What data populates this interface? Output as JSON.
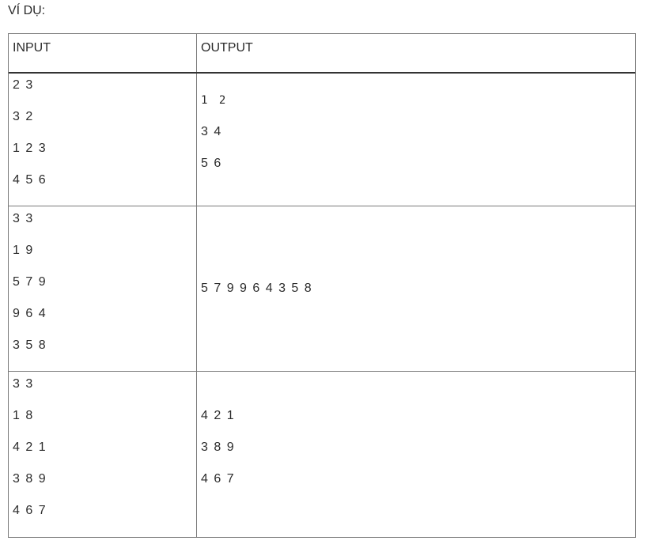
{
  "heading": "VÍ DỤ:",
  "table": {
    "headers": {
      "input": "INPUT",
      "output": "OUTPUT"
    },
    "rows": [
      {
        "input": [
          "2 3",
          "3 2",
          "1 2 3",
          "4 5 6"
        ],
        "output": [
          "1 2",
          "3 4",
          "5 6"
        ]
      },
      {
        "input": [
          "3 3",
          "1 9",
          "5 7 9",
          "9 6 4",
          "3 5 8"
        ],
        "output": [
          "5 7 9 9 6 4 3 5 8"
        ]
      },
      {
        "input": [
          "3 3",
          "1 8",
          "4 2 1",
          "3 8 9",
          "4 6 7"
        ],
        "output": [
          "4 2 1",
          "3 8 9",
          "4 6 7"
        ]
      }
    ]
  }
}
